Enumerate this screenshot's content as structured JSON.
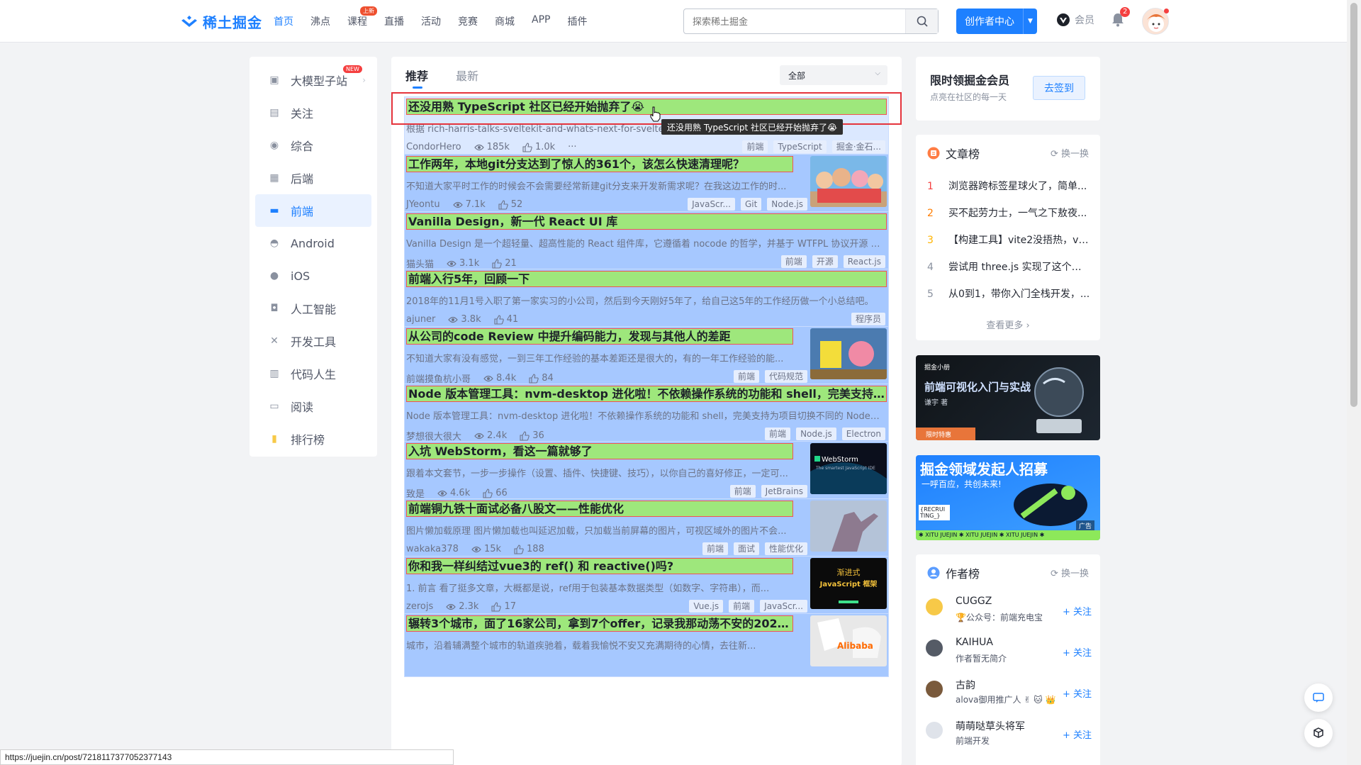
{
  "header": {
    "logo_text": "稀土掘金",
    "nav": [
      {
        "label": "首页",
        "active": true
      },
      {
        "label": "沸点"
      },
      {
        "label": "课程",
        "badge": "上新"
      },
      {
        "label": "直播"
      },
      {
        "label": "活动"
      },
      {
        "label": "竞赛"
      },
      {
        "label": "商城"
      },
      {
        "label": "APP"
      },
      {
        "label": "插件"
      }
    ],
    "search_placeholder": "探索稀土掘金",
    "creator_label": "创作者中心",
    "vip_label": "会员",
    "notification_count": "2"
  },
  "sidebar": {
    "items": [
      {
        "label": "大模型子站",
        "badge": "NEW",
        "icon": "cube-icon"
      },
      {
        "label": "关注",
        "icon": "follow-icon"
      },
      {
        "label": "综合",
        "icon": "compass-icon"
      },
      {
        "label": "后端",
        "icon": "backend-icon"
      },
      {
        "label": "前端",
        "icon": "frontend-icon",
        "active": true
      },
      {
        "label": "Android",
        "icon": "android-icon"
      },
      {
        "label": "iOS",
        "icon": "apple-icon"
      },
      {
        "label": "人工智能",
        "icon": "robot-icon"
      },
      {
        "label": "开发工具",
        "icon": "tools-icon"
      },
      {
        "label": "代码人生",
        "icon": "code-icon"
      },
      {
        "label": "阅读",
        "icon": "book-icon"
      },
      {
        "label": "排行榜",
        "icon": "ranking-icon"
      }
    ]
  },
  "feed": {
    "tabs": [
      "推荐",
      "最新"
    ],
    "filter_label": "全部",
    "tooltip": "还没用熟 TypeScript 社区已经开始抛弃了😭",
    "articles": [
      {
        "title": "还没用熟 TypeScript 社区已经开始抛弃了😭",
        "abstract": "根据 rich-harris-talks-sveltekit-and-whats-next-for-svelte 这篇文章的报道， Svelte 放弃了 JS 了",
        "author": "CondorHero",
        "views": "185k",
        "likes": "1.0k",
        "tags": [
          "前端",
          "TypeScript",
          "掘金·金石..."
        ],
        "more": "···"
      },
      {
        "title": "工作两年，本地git分支达到了惊人的361个，该怎么快速清理呢？",
        "abstract": "不知道大家平时工作的时候会不会需要经常新建git分支来开发新需求呢？在我这边工作的时...",
        "author": "JYeontu",
        "views": "7.1k",
        "likes": "52",
        "tags": [
          "JavaScr...",
          "Git",
          "Node.js"
        ],
        "thumb": "cartoon"
      },
      {
        "title": "Vanilla Design，新一代 React UI 库",
        "abstract": "Vanilla Design 是一个超轻量、超高性能的 React 组件库，它遵循着 nocode 的哲学，并基于 WTFPL 协议开源 (整...",
        "author": "猫头猫",
        "views": "3.1k",
        "likes": "21",
        "tags": [
          "前端",
          "开源",
          "React.js"
        ]
      },
      {
        "title": "前端入行5年，回顾一下",
        "abstract": "2018年的11月1号入职了第一家实习的小公司，然后到今天刚好5年了，给自己这5年的工作经历做一个小总结吧。",
        "author": "ajuner",
        "views": "3.8k",
        "likes": "41",
        "tags": [
          "程序员"
        ]
      },
      {
        "title": "从公司的code Review 中提升编码能力，发现与其他人的差距",
        "abstract": "不知道大家有没有感觉，一到三年工作经验的基本差距还是很大的，有的一年工作经验的能...",
        "author": "前端摸鱼杭小哥",
        "views": "8.4k",
        "likes": "84",
        "tags": [
          "前端",
          "代码规范"
        ],
        "thumb": "sponge"
      },
      {
        "title": "Node 版本管理工具：nvm-desktop 进化啦！不依赖操作系统的功能和 shell，完美支持为...",
        "abstract": "Node 版本管理工具：nvm-desktop 进化啦！不依赖操作系统的功能和 shell，完美支持为项目切换不同的 Node 版...",
        "author": "梦想很大很大",
        "views": "2.4k",
        "likes": "36",
        "tags": [
          "前端",
          "Node.js",
          "Electron"
        ]
      },
      {
        "title": "入坑 WebStorm，看这一篇就够了",
        "abstract": "跟着本文套节，一步一步操作（设置、插件、快捷键、技巧），以你自己的喜好修正，一定可...",
        "author": "致是",
        "views": "4.6k",
        "likes": "66",
        "tags": [
          "前端",
          "JetBrains"
        ],
        "thumb": "webstorm",
        "thumb_title": "WebStorm",
        "thumb_sub": "The smartest JavaScript IDE"
      },
      {
        "title": "前端铜九铁十面试必备八股文——性能优化",
        "abstract": "图片懒加载原理 图片懒加载也叫延迟加载，只加载当前屏幕的图片，可视区域外的图片不会...",
        "author": "wakaka378",
        "views": "15k",
        "likes": "188",
        "tags": [
          "前端",
          "面试",
          "性能优化"
        ],
        "thumb": "statue"
      },
      {
        "title": "你和我一样纠结过vue3的 ref() 和 reactive()吗?",
        "abstract": "1. 前言 看了挺多文章，大概都是说，ref用于包装基本数据类型（如数字、字符串），而...",
        "author": "zerojs",
        "views": "2.3k",
        "likes": "17",
        "tags": [
          "Vue.js",
          "前端",
          "JavaScr..."
        ],
        "thumb": "js",
        "thumb_title": "渐进式",
        "thumb_sub": "JavaScript 框架"
      },
      {
        "title": "辗转3个城市，面了16家公司，拿到7个offer，记录我那动荡不安的2023...",
        "abstract": "城市，沿着辅满整个城市的轨道疾驰着，载着我愉悦不安又充满期待的心情，去往新...",
        "author": "",
        "views": "",
        "likes": "",
        "tags": [],
        "thumb": "alibaba",
        "thumb_title": "Alibaba"
      }
    ]
  },
  "right": {
    "signin": {
      "title": "限时领掘金会员",
      "subtitle": "点亮在社区的每一天",
      "button": "去签到"
    },
    "article_rank": {
      "title": "文章榜",
      "refresh": "换一换",
      "items": [
        {
          "num": "1",
          "text": "浏览器跨标签星球火了，简单..."
        },
        {
          "num": "2",
          "text": "买不起劳力士，一气之下敖夜..."
        },
        {
          "num": "3",
          "text": "【构建工具】vite2没捂热，vit..."
        },
        {
          "num": "4",
          "text": "尝试用 three.js 实现了这个跨..."
        },
        {
          "num": "5",
          "text": "从0到1，带你入门全栈开发，..."
        }
      ],
      "more": "查看更多 ›"
    },
    "banner1": {
      "brand": "掘金小册",
      "title": "前端可视化入门与实战",
      "author": "谦宇 著",
      "tag": "限时特惠"
    },
    "banner2": {
      "title": "掘金领域发起人招募",
      "sub": "一呼百应，共创未来!",
      "recruit": "{RECRUI TING_}",
      "ad": "广告",
      "footer": "✱ XITU JUEJIN ✱ XITU JUEJIN ✱ XITU JUEJIN ✱"
    },
    "author_rank": {
      "title": "作者榜",
      "refresh": "换一换",
      "items": [
        {
          "name": "CUGGZ",
          "desc": "🏆公众号：前端充电宝",
          "follow": "+ 关注",
          "color": "#f7c948"
        },
        {
          "name": "KAIHUA",
          "desc": "作者暂无简介",
          "follow": "+ 关注",
          "color": "#555b66"
        },
        {
          "name": "古韵",
          "desc": "alova御用推广人 ✌ 🐱 👑",
          "follow": "+ 关注",
          "color": "#7a5a3c"
        },
        {
          "name": "萌萌哒草头将军",
          "desc": "前端开发",
          "follow": "+ 关注",
          "color": "#dfe3ea"
        }
      ]
    }
  },
  "statusbar": {
    "url": "https://juejin.cn/post/7218117377052377143"
  },
  "colors": {
    "brand": "#1e80ff",
    "highlight_red": "#e5343c",
    "title_green": "#9ee77c",
    "card_blue": "#a6c8ff"
  }
}
